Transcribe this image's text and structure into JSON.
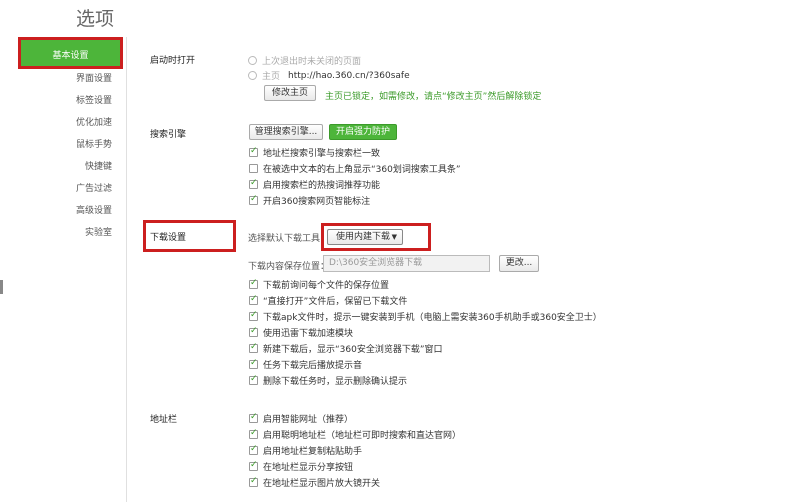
{
  "header": {
    "title": "选项"
  },
  "sidebar": {
    "items": [
      {
        "label": "基本设置"
      },
      {
        "label": "界面设置"
      },
      {
        "label": "标签设置"
      },
      {
        "label": "优化加速"
      },
      {
        "label": "鼠标手势"
      },
      {
        "label": "快捷键"
      },
      {
        "label": "广告过滤"
      },
      {
        "label": "高级设置"
      },
      {
        "label": "实验室"
      }
    ]
  },
  "startup": {
    "title": "启动时打开",
    "option_restore": "上次退出时未关闭的页面",
    "option_home_label": "主页",
    "home_url": "http://hao.360.cn/?360safe",
    "change_home_button": "修改主页",
    "lock_note": "主页已锁定，如需修改，请点“修改主页”然后解除锁定"
  },
  "search": {
    "title": "搜索引擎",
    "manage_button": "管理搜索引擎...",
    "protect_button": "开启强力防护",
    "options": [
      {
        "label": "地址栏搜索引擎与搜索栏一致",
        "checked": true
      },
      {
        "label": "在被选中文本的右上角显示“360划词搜索工具条”",
        "checked": false
      },
      {
        "label": "启用搜索栏的热搜词推荐功能",
        "checked": true
      },
      {
        "label": "开启360搜索网页智能标注",
        "checked": true
      }
    ]
  },
  "download": {
    "title": "下载设置",
    "tool_label": "选择默认下载工具",
    "tool_selected": "使用内建下载",
    "save_location_label": "下载内容保存位置：",
    "save_path": "D:\\360安全浏览器下载",
    "change_button": "更改...",
    "options": [
      {
        "label": "下载前询问每个文件的保存位置",
        "checked": true
      },
      {
        "label": "“直接打开”文件后，保留已下载文件",
        "checked": true
      },
      {
        "label": "下载apk文件时，提示一键安装到手机（电脑上需安装360手机助手或360安全卫士）",
        "checked": true
      },
      {
        "label": "使用迅雷下载加速模块",
        "checked": true
      },
      {
        "label": "新建下载后，显示“360安全浏览器下载”窗口",
        "checked": true
      },
      {
        "label": "任务下载完后播放提示音",
        "checked": true
      },
      {
        "label": "删除下载任务时，显示删除确认提示",
        "checked": true
      }
    ]
  },
  "addressbar": {
    "title": "地址栏",
    "options": [
      {
        "label": "启用智能网址（推荐）",
        "checked": true
      },
      {
        "label": "启用聪明地址栏（地址栏可即时搜索和直达官网）",
        "checked": true
      },
      {
        "label": "启用地址栏复制粘贴助手",
        "checked": true
      },
      {
        "label": "在地址栏显示分享按钮",
        "checked": true
      },
      {
        "label": "在地址栏显示图片放大镜开关",
        "checked": true
      }
    ]
  }
}
